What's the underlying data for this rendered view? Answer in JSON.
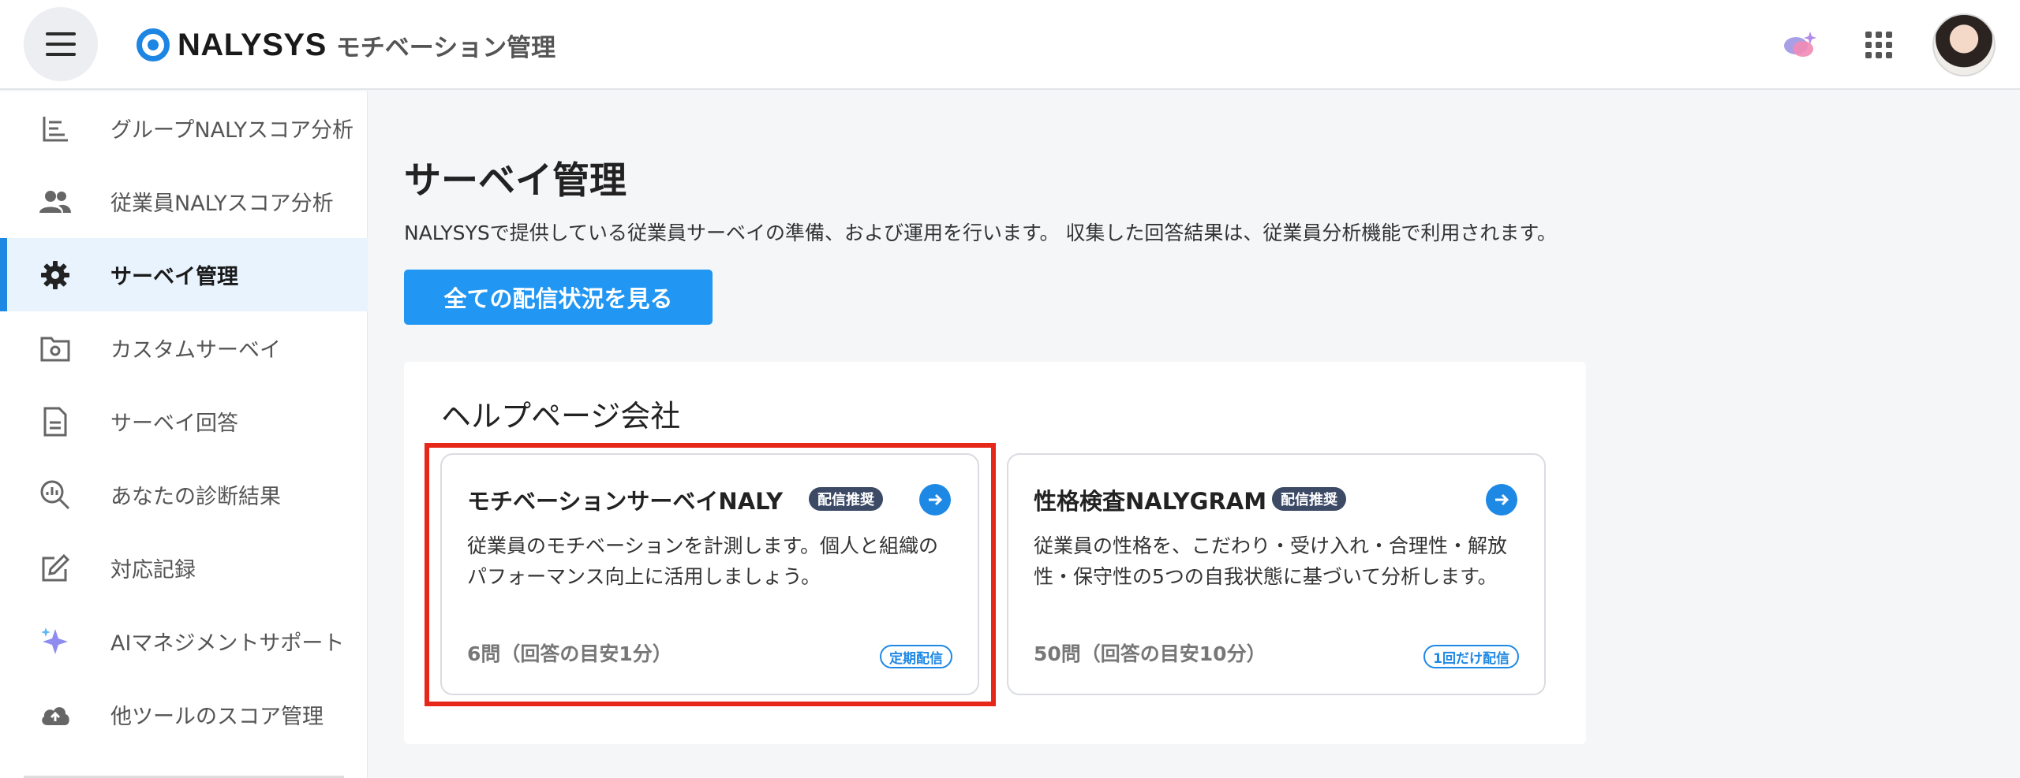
{
  "header": {
    "logo_text": "NALYSYS",
    "logo_subtitle": "モチベーション管理"
  },
  "sidebar": {
    "items": [
      {
        "label": "グループNALYスコア分析",
        "icon": "bar-chart-icon"
      },
      {
        "label": "従業員NALYスコア分析",
        "icon": "people-icon"
      },
      {
        "label": "サーベイ管理",
        "icon": "gear-icon",
        "active": true
      },
      {
        "label": "カスタムサーベイ",
        "icon": "folder-gear-icon"
      },
      {
        "label": "サーベイ回答",
        "icon": "document-icon"
      },
      {
        "label": "あなたの診断結果",
        "icon": "analytics-search-icon"
      },
      {
        "label": "対応記録",
        "icon": "edit-icon"
      },
      {
        "label": "AIマネジメントサポート",
        "icon": "sparkle-icon"
      },
      {
        "label": "他ツールのスコア管理",
        "icon": "cloud-upload-icon"
      }
    ]
  },
  "main": {
    "title": "サーベイ管理",
    "description": "NALYSYSで提供している従業員サーベイの準備、および運用を行います。 収集した回答結果は、従業員分析機能で利用されます。",
    "view_all_button": "全ての配信状況を見る",
    "company_name": "ヘルプページ会社",
    "cards": [
      {
        "title": "モチベーションサーベイNALY",
        "badge": "配信推奨",
        "description": "従業員のモチベーションを計測します。個人と組織のパフォーマンス向上に活用しましょう。",
        "count": "6問（回答の目安1分）",
        "tag": "定期配信"
      },
      {
        "title": "性格検査NALYGRAM",
        "badge": "配信推奨",
        "description": "従業員の性格を、こだわり・受け入れ・合理性・解放性・保守性の5つの自我状態に基づいて分析します。",
        "count": "50問（回答の目安10分）",
        "tag": "1回だけ配信"
      }
    ]
  },
  "colors": {
    "accent": "#2196f3",
    "badge_bg": "#3c4a66",
    "highlight": "#e8271b",
    "active_nav_bg": "#e8f3fd"
  }
}
